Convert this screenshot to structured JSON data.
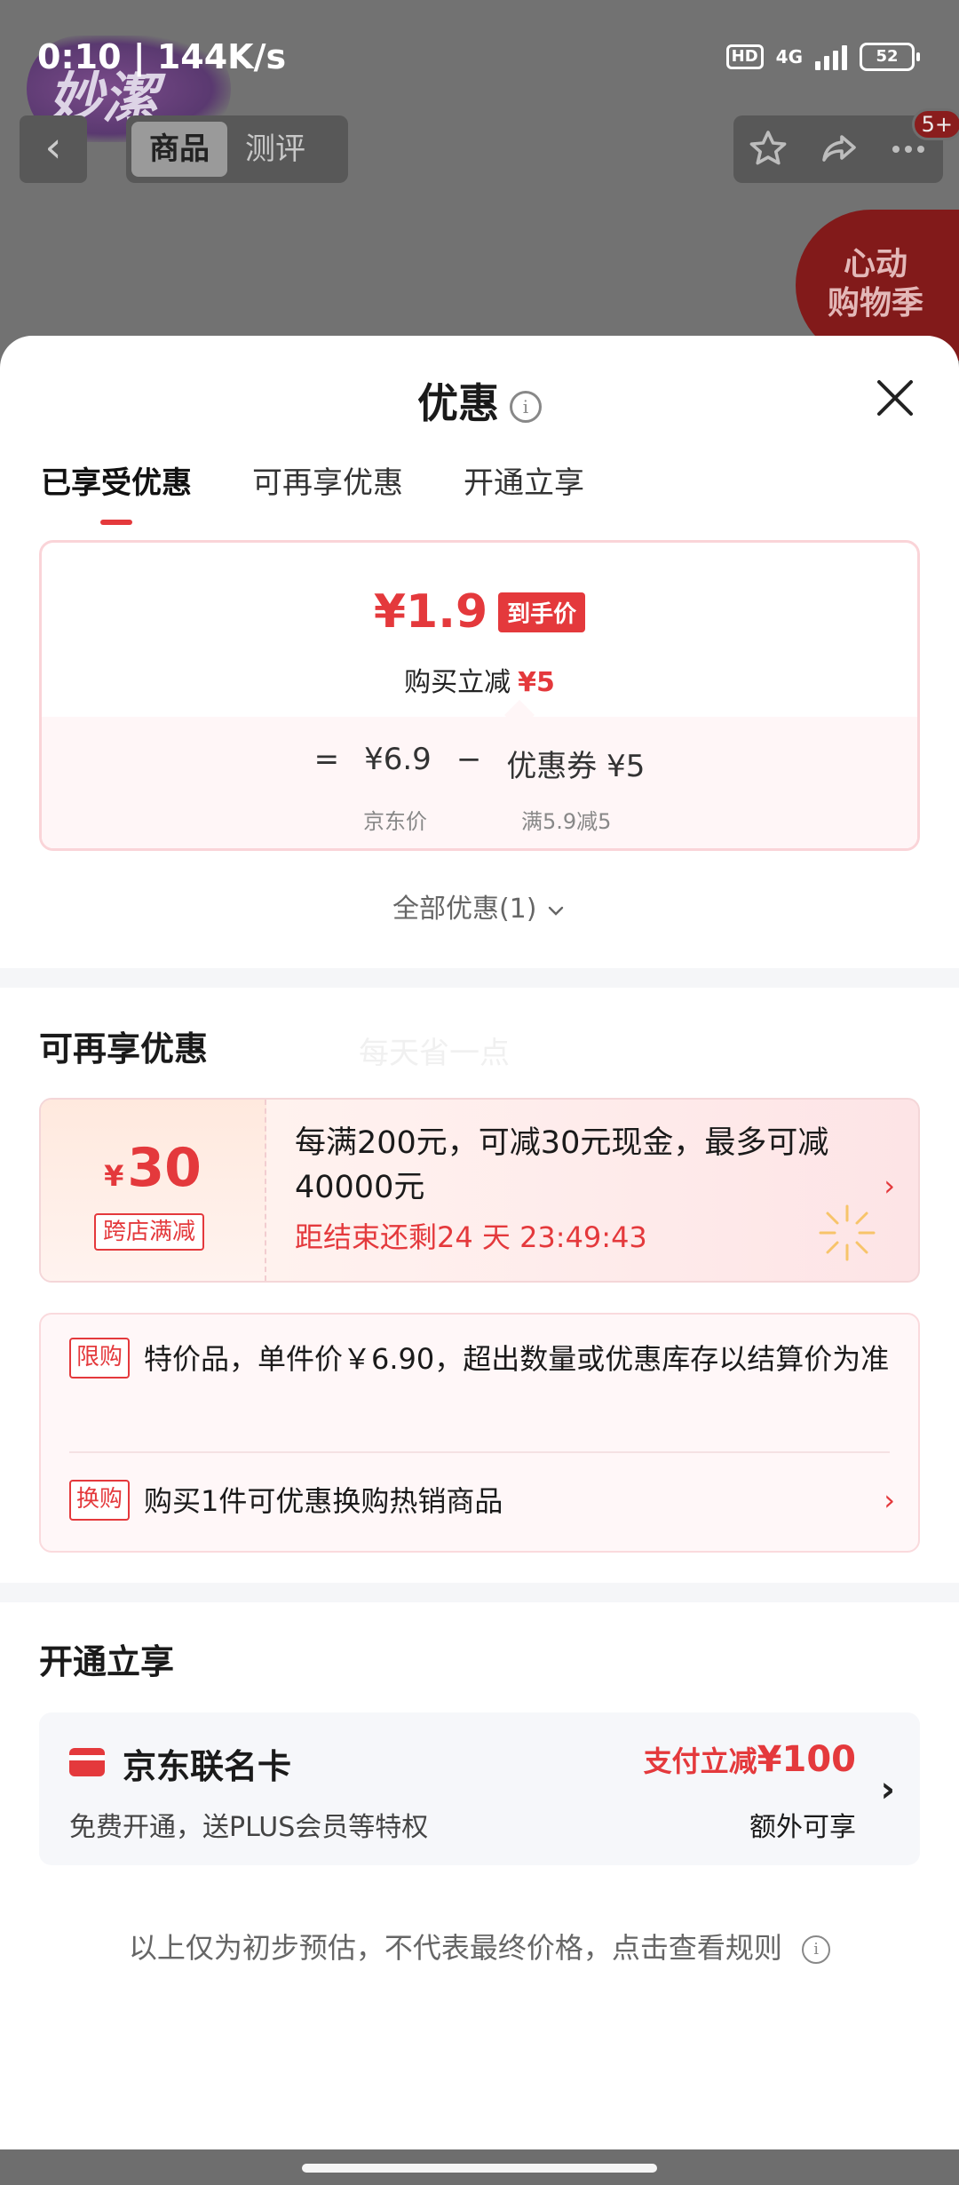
{
  "status_bar": {
    "time_speed": "0:10 | 144K/s",
    "hd": "HD",
    "network": "4G",
    "battery": "52"
  },
  "background": {
    "logo_text": "妙潔",
    "tabs": [
      "商品",
      "测评"
    ],
    "badge": "5+",
    "promo_line1": "心动",
    "promo_line2": "购物季"
  },
  "sheet": {
    "title": "优惠",
    "info_glyph": "i",
    "tabs": [
      "已享受优惠",
      "可再享优惠",
      "开通立享"
    ],
    "price_card": {
      "final_price": "¥1.9",
      "final_tag": "到手价",
      "reduce_label": "购买立减",
      "reduce_amount": "¥5",
      "equals": "=",
      "jd_price": "¥6.9",
      "minus": "−",
      "coupon_label": "优惠券 ¥5",
      "jd_price_caption": "京东价",
      "coupon_caption": "满5.9减5"
    },
    "all_promos": "全部优惠(1)",
    "more_section": {
      "title": "可再享优惠",
      "watermark": "每天省一点",
      "cross_store": {
        "currency": "¥",
        "amount": "30",
        "tag": "跨店满减",
        "desc": "每满200元，可减30元现金，最多可减40000元",
        "countdown": "距结束还剩24 天 23:49:43"
      },
      "rules": [
        {
          "tag": "限购",
          "text": "特价品，单件价￥6.90，超出数量或优惠库存以结算价为准"
        },
        {
          "tag": "换购",
          "text": "购买1件可优惠换购热销商品"
        }
      ]
    },
    "open_section": {
      "title": "开通立享",
      "card_name": "京东联名卡",
      "card_sub": "免费开通，送PLUS会员等特权",
      "price_prefix": "支付立减",
      "price_amount": "¥100",
      "extra": "额外可享"
    },
    "footer": "以上仅为初步预估，不代表最终价格，点击查看规则"
  },
  "colors": {
    "accent": "#e4393c",
    "overlay": "#727272",
    "card_bg": "#f6f7fa"
  }
}
